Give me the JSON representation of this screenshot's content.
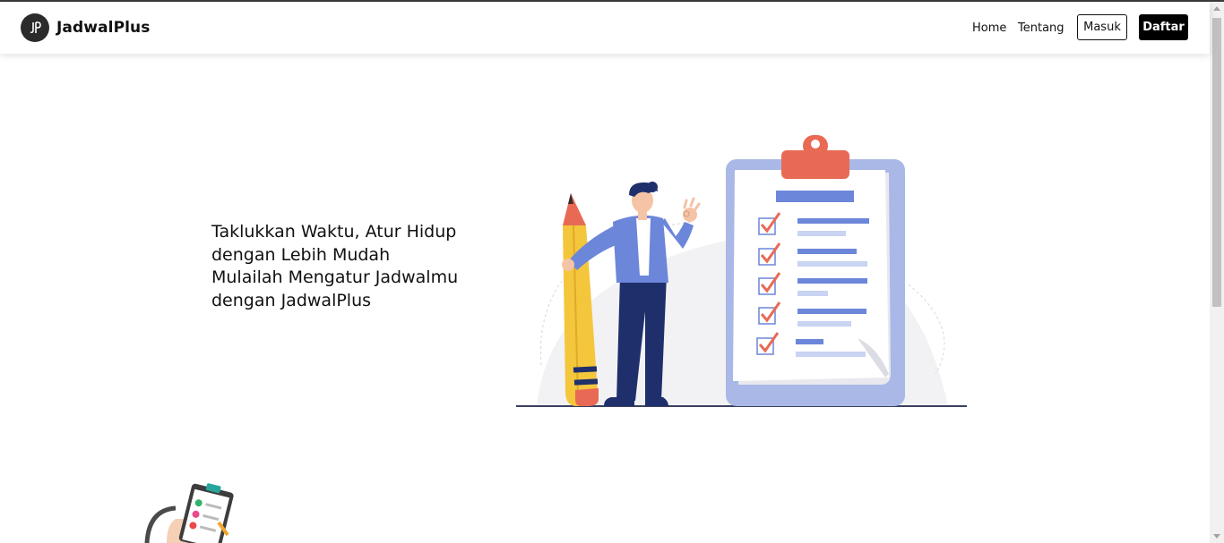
{
  "brand": {
    "name": "JadwalPlus",
    "logo_icon": "jp-logo-icon"
  },
  "nav": {
    "home": "Home",
    "tentang": "Tentang",
    "masuk": "Masuk",
    "daftar": "Daftar"
  },
  "hero": {
    "line1": "Taklukkan Waktu, Atur Hidup",
    "line2": "dengan Lebih Mudah",
    "line3": "Mulailah Mengatur Jadwalmu",
    "line4": "dengan JadwalPlus"
  },
  "colors": {
    "clipboard_frame": "#a9b8e6",
    "clip": "#e86a55",
    "accent_blue": "#6c86d9",
    "pencil": "#f4c63c",
    "navy": "#1e2f6b"
  }
}
